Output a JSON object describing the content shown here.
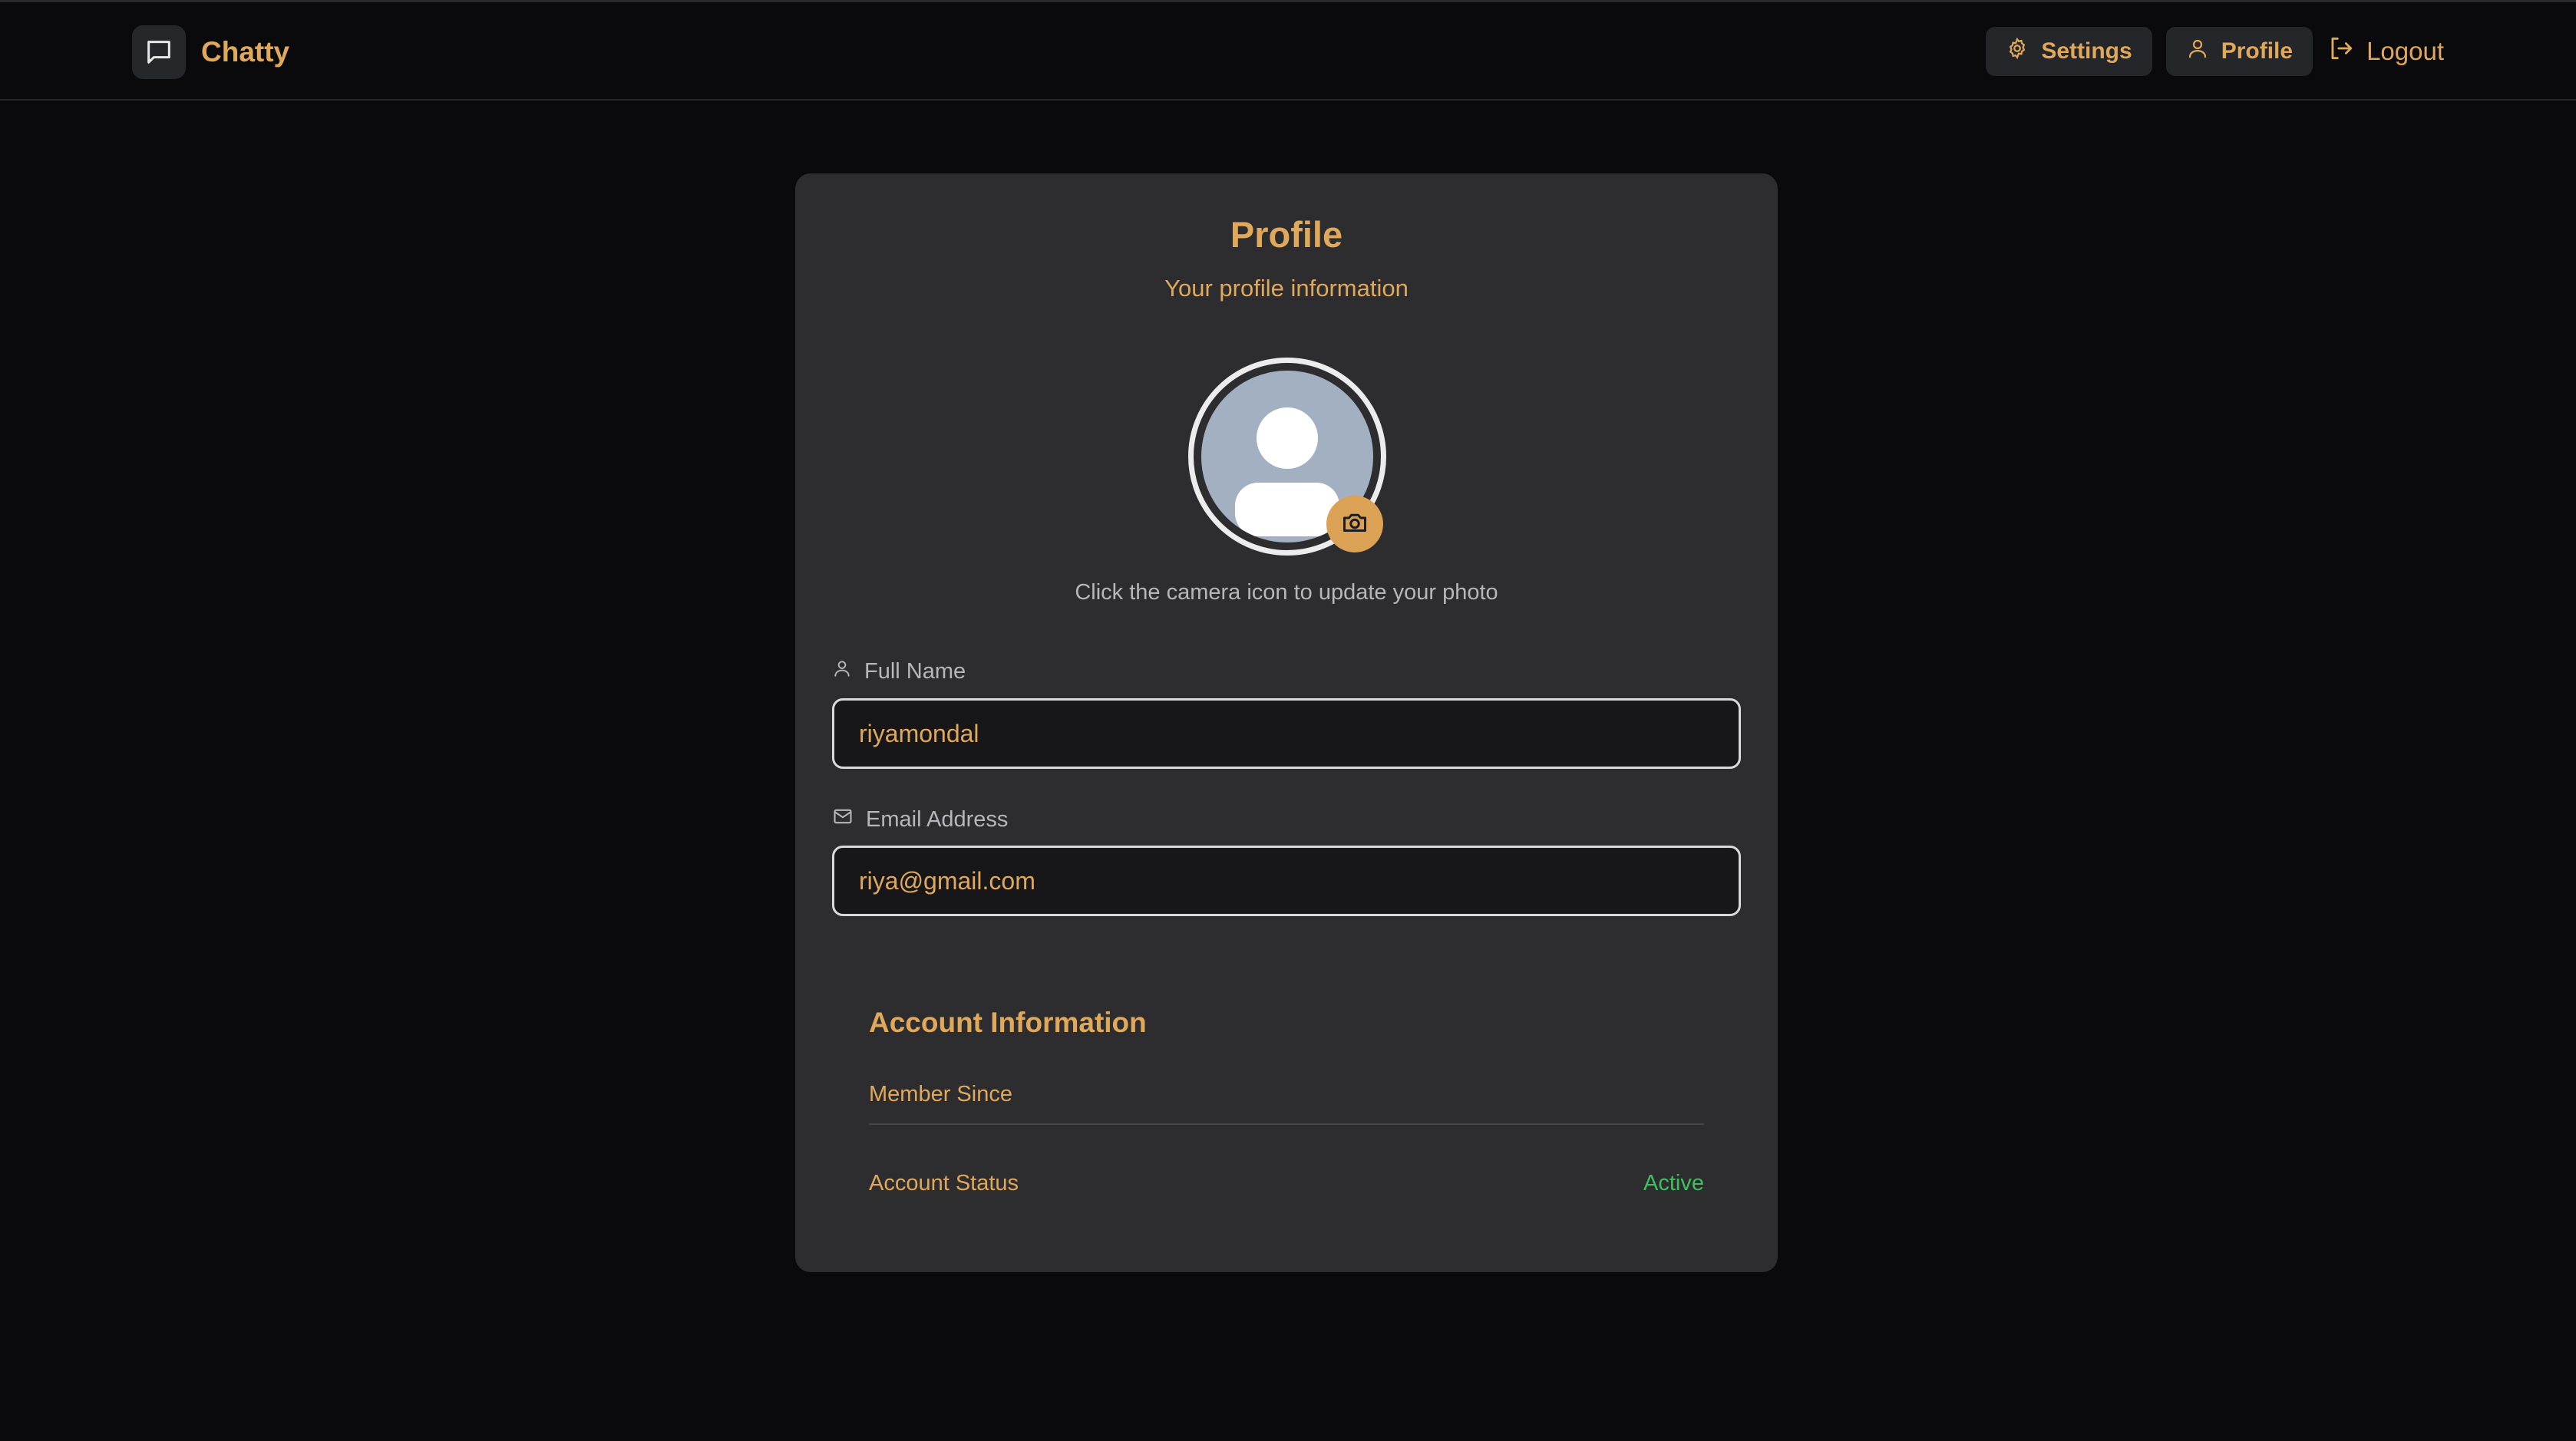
{
  "app": {
    "name": "Chatty"
  },
  "nav": {
    "settings": "Settings",
    "profile": "Profile",
    "logout": "Logout"
  },
  "profile": {
    "title": "Profile",
    "subtitle": "Your profile information",
    "photo_hint": "Click the camera icon to update your photo",
    "full_name_label": "Full Name",
    "full_name_value": "riyamondal",
    "email_label": "Email Address",
    "email_value": "riya@gmail.com"
  },
  "account": {
    "title": "Account Information",
    "member_since_label": "Member Since",
    "member_since_value": "",
    "status_label": "Account Status",
    "status_value": "Active"
  },
  "colors": {
    "accent": "#e0a85a",
    "background": "#0a0a0c",
    "card": "#2d2d30",
    "status_active": "#3fbf61"
  },
  "icons": [
    "message-square-icon",
    "gear-icon",
    "user-icon",
    "logout-icon",
    "camera-icon",
    "mail-icon",
    "avatar-placeholder"
  ]
}
